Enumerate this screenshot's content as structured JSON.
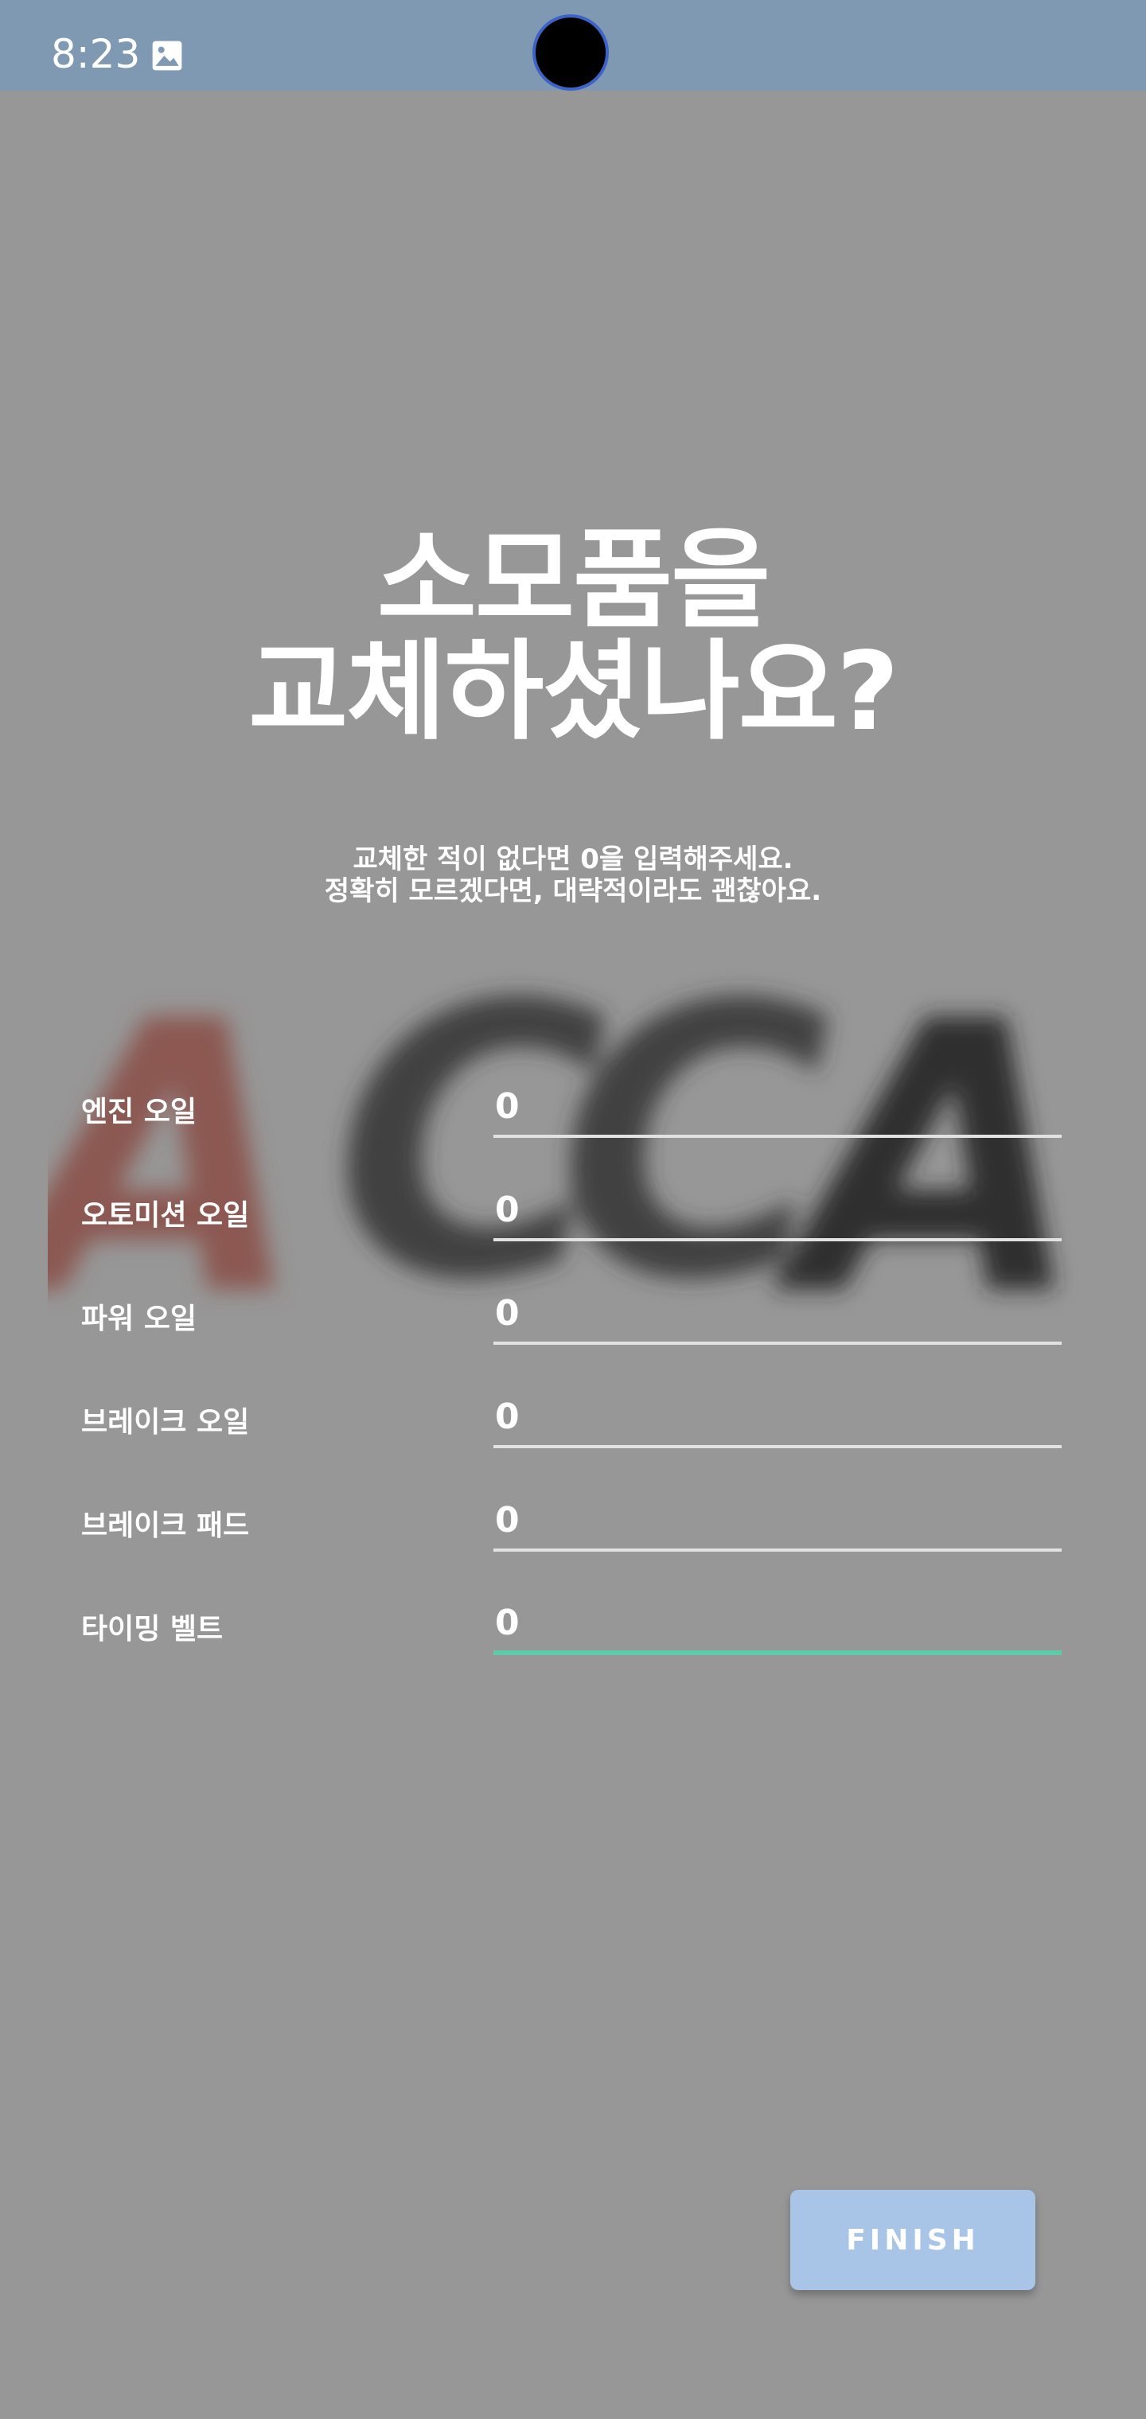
{
  "status_bar": {
    "time": "8:23",
    "icons": [
      "image-icon"
    ],
    "background_color": "#7f99b3"
  },
  "title": {
    "line1": "소모품을",
    "line2": "교체하셨나요?"
  },
  "subtitle": {
    "line1": "교체한 적이 없다면 0을 입력해주세요.",
    "line2": "정확히 모르겠다면, 대략적이라도 괜찮아요."
  },
  "background_watermark": {
    "letters": [
      "A",
      "C",
      "C",
      "A"
    ],
    "colors": [
      "#8a4c45",
      "#3a3a3a",
      "#3a3a3a",
      "#2a2a2a"
    ]
  },
  "form": {
    "rows": [
      {
        "label": "엔진 오일",
        "value": "0"
      },
      {
        "label": "오토미션 오일",
        "value": "0"
      },
      {
        "label": "파워 오일",
        "value": "0"
      },
      {
        "label": "브레이크 오일",
        "value": "0"
      },
      {
        "label": "브레이크 패드",
        "value": "0"
      },
      {
        "label": "타이밍 벨트",
        "value": "0",
        "focused": true
      }
    ],
    "underline_color": "#e2e2e2",
    "focus_color": "#5fcaaa"
  },
  "finish_button": {
    "label": "FINISH",
    "background_color": "#a8c4e6"
  },
  "colors": {
    "page_background": "#979797",
    "text": "#ffffff"
  }
}
